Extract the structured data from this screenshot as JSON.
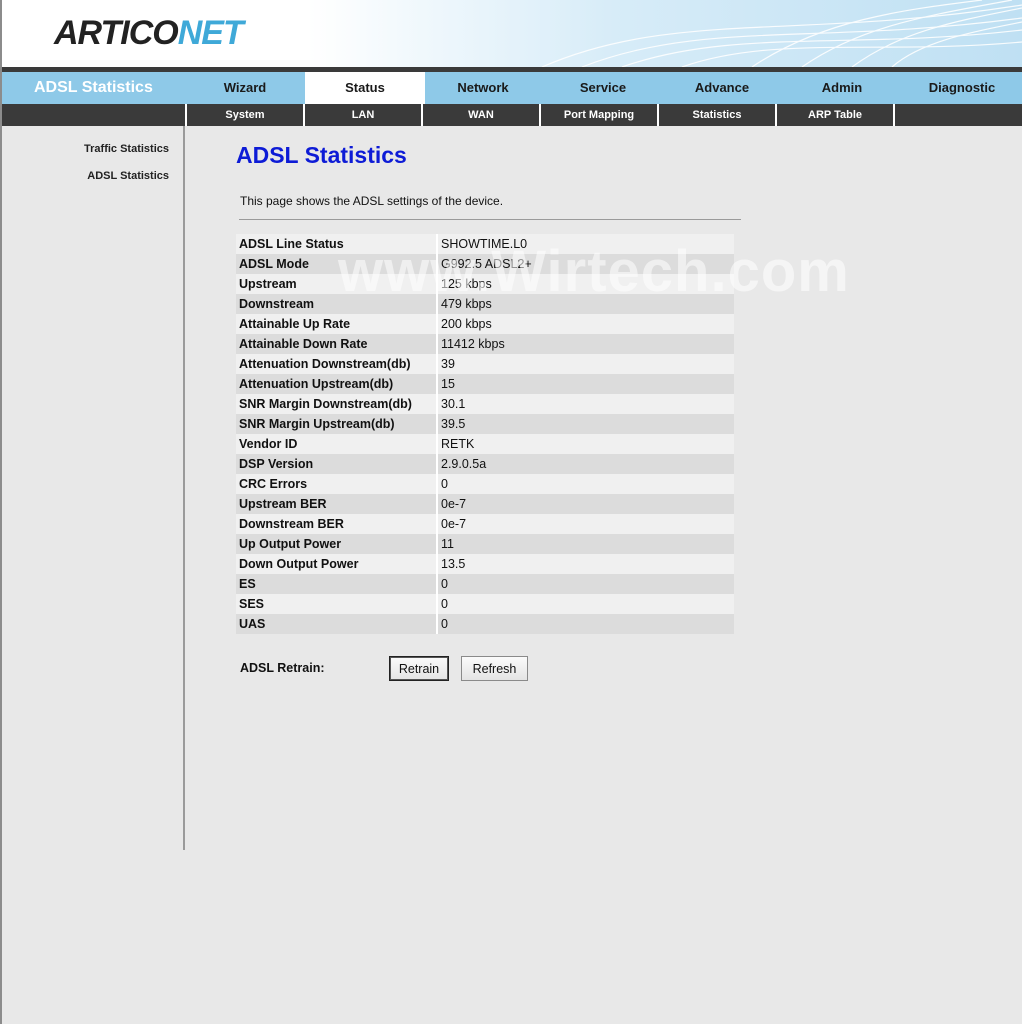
{
  "logo": {
    "part1": "ARTICO",
    "part2": "NET"
  },
  "nav": {
    "title": "ADSL Statistics",
    "items": [
      "Wizard",
      "Status",
      "Network",
      "Service",
      "Advance",
      "Admin",
      "Diagnostic"
    ],
    "active": "Status"
  },
  "subnav": [
    "System",
    "LAN",
    "WAN",
    "Port Mapping",
    "Statistics",
    "ARP Table"
  ],
  "sidebar": [
    "Traffic Statistics",
    "ADSL Statistics"
  ],
  "page": {
    "title": "ADSL Statistics",
    "description": "This page shows the ADSL settings of the device.",
    "watermark": "www.Wirtech.com"
  },
  "stats": [
    {
      "label": "ADSL Line Status",
      "value": "SHOWTIME.L0"
    },
    {
      "label": "ADSL Mode",
      "value": "G992.5 ADSL2+"
    },
    {
      "label": "Upstream",
      "value": "125 kbps"
    },
    {
      "label": "Downstream",
      "value": "479 kbps"
    },
    {
      "label": "Attainable Up Rate",
      "value": "200 kbps"
    },
    {
      "label": "Attainable Down Rate",
      "value": "11412 kbps"
    },
    {
      "label": "Attenuation Downstream(db)",
      "value": "39"
    },
    {
      "label": "Attenuation Upstream(db)",
      "value": "15"
    },
    {
      "label": "SNR Margin Downstream(db)",
      "value": "30.1"
    },
    {
      "label": "SNR Margin Upstream(db)",
      "value": "39.5"
    },
    {
      "label": "Vendor ID",
      "value": "RETK"
    },
    {
      "label": "DSP Version",
      "value": "2.9.0.5a"
    },
    {
      "label": "CRC Errors",
      "value": "0"
    },
    {
      "label": "Upstream BER",
      "value": "0e-7"
    },
    {
      "label": "Downstream BER",
      "value": "0e-7"
    },
    {
      "label": "Up Output Power",
      "value": "11"
    },
    {
      "label": "Down Output Power",
      "value": "13.5"
    },
    {
      "label": "ES",
      "value": "0"
    },
    {
      "label": "SES",
      "value": "0"
    },
    {
      "label": "UAS",
      "value": "0"
    }
  ],
  "retrain": {
    "label": "ADSL Retrain:",
    "retrain_button": "Retrain",
    "refresh_button": "Refresh"
  },
  "colors": {
    "nav_bg": "#8ec9e8",
    "title_blue": "#0d1bd6",
    "subnav_bg": "#3a3a3a"
  }
}
